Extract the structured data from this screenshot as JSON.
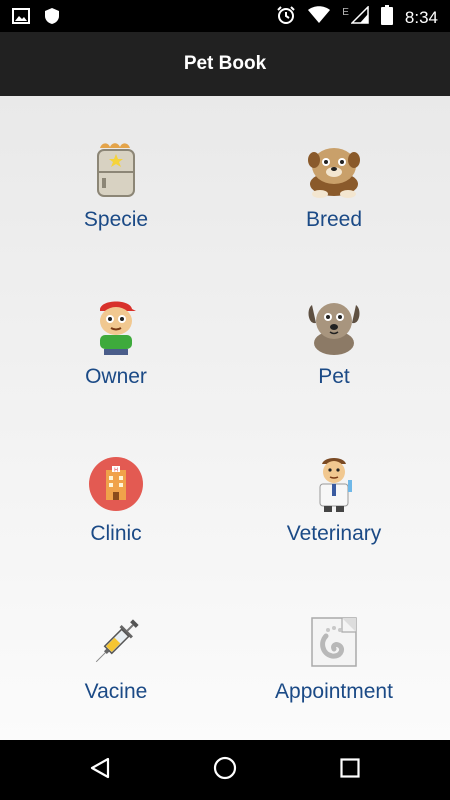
{
  "status_bar": {
    "time": "8:34",
    "network_label": "E",
    "icons": [
      "image-icon",
      "shield-icon",
      "alarm-icon",
      "wifi-icon",
      "signal-icon",
      "battery-icon"
    ]
  },
  "app_bar": {
    "title": "Pet Book"
  },
  "menu": {
    "items": [
      {
        "label": "Specie",
        "icon": "specie-icon"
      },
      {
        "label": "Breed",
        "icon": "bulldog-icon"
      },
      {
        "label": "Owner",
        "icon": "owner-icon"
      },
      {
        "label": "Pet",
        "icon": "dog-icon"
      },
      {
        "label": "Clinic",
        "icon": "clinic-icon"
      },
      {
        "label": "Veterinary",
        "icon": "veterinarian-icon"
      },
      {
        "label": "Vacine",
        "icon": "syringe-icon"
      },
      {
        "label": "Appointment",
        "icon": "calendar-note-icon"
      }
    ]
  },
  "nav_bar": {
    "buttons": [
      "back-icon",
      "home-icon",
      "recents-icon"
    ]
  },
  "colors": {
    "label": "#1b4a86",
    "app_bar": "#212121",
    "status_bar": "#000000"
  }
}
